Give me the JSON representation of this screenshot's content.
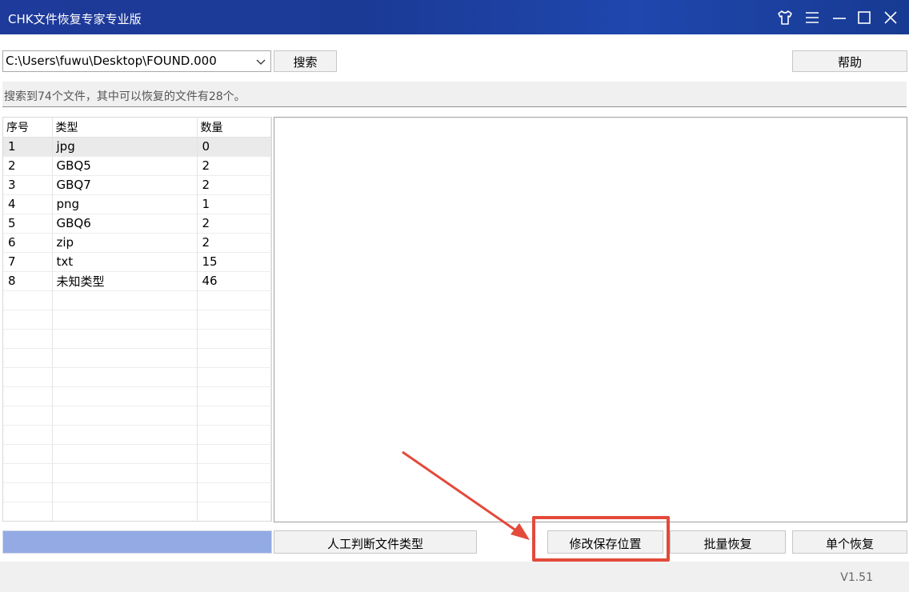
{
  "window": {
    "title": "CHK文件恢复专家专业版"
  },
  "toolbar": {
    "path_value": "C:\\Users\\fuwu\\Desktop\\FOUND.000",
    "search_label": "搜索",
    "help_label": "帮助"
  },
  "status": {
    "text": "搜索到74个文件，其中可以恢复的文件有28个。"
  },
  "table": {
    "headers": [
      "序号",
      "类型",
      "数量"
    ],
    "rows": [
      {
        "index": "1",
        "type": "jpg",
        "count": "0"
      },
      {
        "index": "2",
        "type": "GBQ5",
        "count": "2"
      },
      {
        "index": "3",
        "type": "GBQ7",
        "count": "2"
      },
      {
        "index": "4",
        "type": "png",
        "count": "1"
      },
      {
        "index": "5",
        "type": "GBQ6",
        "count": "2"
      },
      {
        "index": "6",
        "type": "zip",
        "count": "2"
      },
      {
        "index": "7",
        "type": "txt",
        "count": "15"
      },
      {
        "index": "8",
        "type": "未知类型",
        "count": "46"
      }
    ],
    "selected_row_index": "1"
  },
  "progress": {
    "fraction": 1.0
  },
  "actions": {
    "manual_type_label": "人工判断文件类型",
    "change_location_label": "修改保存位置",
    "batch_recover_label": "批量恢复",
    "single_recover_label": "单个恢复"
  },
  "footer": {
    "version": "V1.51"
  },
  "colors": {
    "titlebar": "#1e3a9a",
    "progress_fill": "#93aae5",
    "annotation": "#e34a3a"
  },
  "icons": {
    "skin": "tshirt-icon",
    "menu": "menu-icon",
    "minimize": "minimize-icon",
    "maximize": "maximize-icon",
    "close": "close-icon",
    "dropdown": "chevron-down-icon"
  }
}
